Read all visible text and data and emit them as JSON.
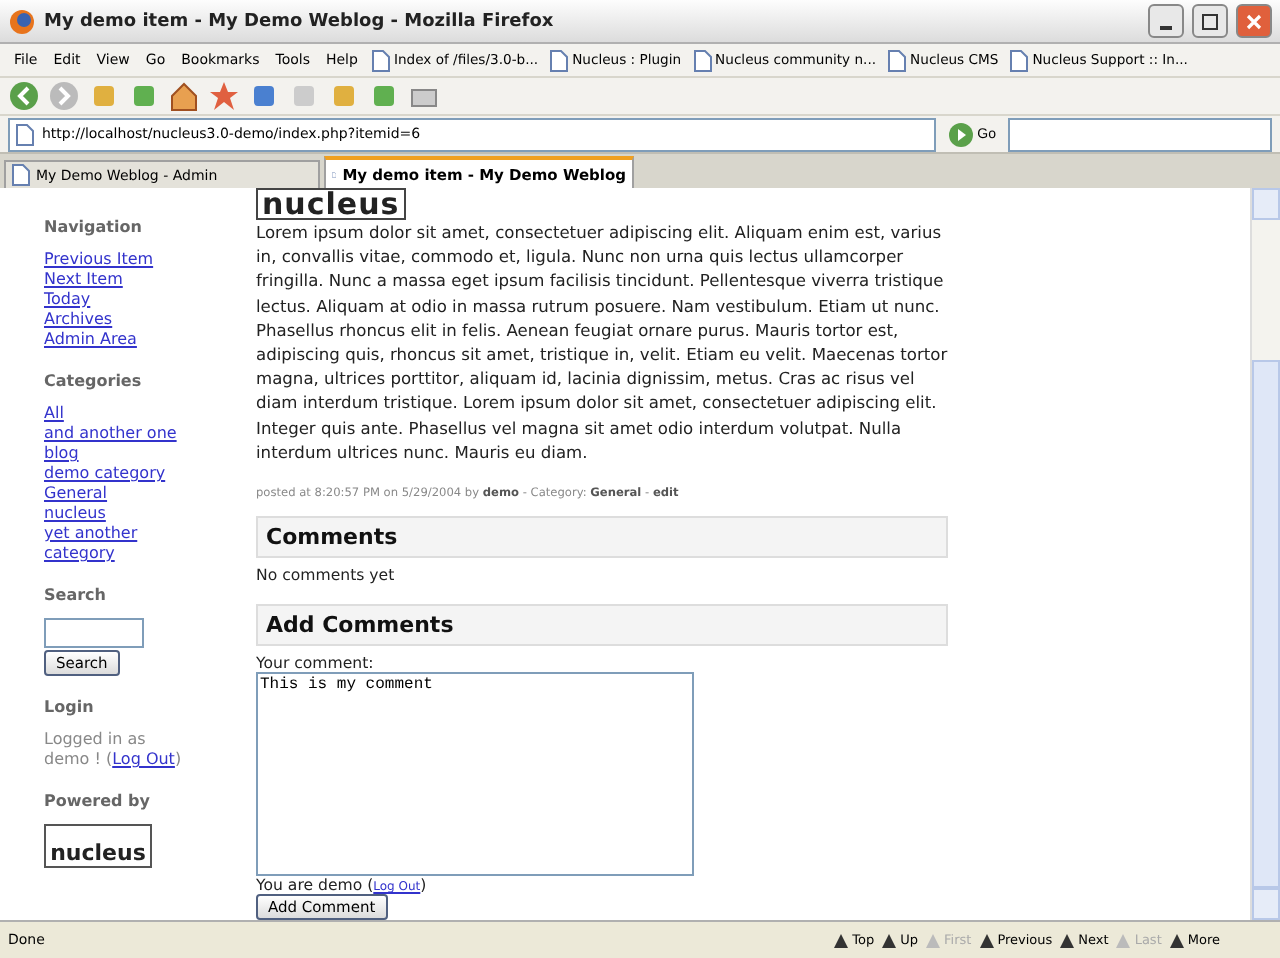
{
  "window": {
    "title": "My demo item - My Demo Weblog - Mozilla Firefox"
  },
  "menu": [
    "File",
    "Edit",
    "View",
    "Go",
    "Bookmarks",
    "Tools",
    "Help"
  ],
  "bookmarks": [
    "Index of /files/3.0-b...",
    "Nucleus : Plugin",
    "Nucleus community n...",
    "Nucleus CMS",
    "Nucleus Support :: In..."
  ],
  "address": {
    "url": "http://localhost/nucleus3.0-demo/index.php?itemid=6",
    "go": "Go"
  },
  "tabs": [
    {
      "label": "My Demo Weblog - Admin",
      "selected": false
    },
    {
      "label": "My demo item - My Demo Weblog",
      "selected": true
    }
  ],
  "sidebar": {
    "sections": [
      {
        "kind": "links",
        "heading": "Navigation",
        "links": [
          "Previous Item",
          "Next Item",
          "Today",
          "Archives",
          "Admin Area"
        ]
      },
      {
        "kind": "links",
        "heading": "Categories",
        "links": [
          "All",
          "and another one",
          "blog",
          "demo category",
          "General",
          "nucleus",
          "yet another category"
        ]
      },
      {
        "kind": "search",
        "heading": "Search",
        "button": "Search"
      },
      {
        "kind": "login",
        "heading": "Login",
        "text": "Logged in as demo ! (",
        "link": "Log Out",
        "after": ")"
      },
      {
        "kind": "logo",
        "heading": "Powered by",
        "logo": "nucleus"
      }
    ]
  },
  "post": {
    "logo": "nucleus",
    "body": "Lorem ipsum dolor sit amet, consectetuer adipiscing elit. Aliquam enim est, varius in, convallis vitae, commodo et, ligula. Nunc non urna quis lectus ullamcorper fringilla. Nunc a massa eget ipsum facilisis tincidunt. Pellentesque viverra tristique lectus. Aliquam at odio in massa rutrum posuere. Nam vestibulum. Etiam ut nunc. Phasellus rhoncus elit in felis. Aenean feugiat ornare purus. Mauris tortor est, adipiscing quis, rhoncus sit amet, tristique in, velit. Etiam eu velit. Maecenas tortor magna, ultrices porttitor, aliquam id, lacinia dignissim, metus. Cras ac risus vel diam interdum tristique. Lorem ipsum dolor sit amet, consectetuer adipiscing elit. Integer quis ante. Phasellus vel magna sit amet odio interdum volutpat. Nulla interdum ultrices nunc. Mauris eu diam.",
    "meta": "posted at 8:20:57 PM on 5/29/2004 by **demo** - Category: **General** - **edit**"
  },
  "comments": {
    "heading": "Comments",
    "empty": "No comments yet"
  },
  "add_comment": {
    "heading": "Add Comments",
    "label": "Your comment:",
    "value": "This is my comment",
    "user_text": "You are demo (",
    "logout": "Log Out",
    "user_after": ")",
    "button": "Add Comment"
  },
  "status_bar": {
    "text": "Done",
    "items": [
      {
        "label": "Top",
        "disabled": false
      },
      {
        "label": "Up",
        "disabled": false
      },
      {
        "label": "First",
        "disabled": true
      },
      {
        "label": "Previous",
        "disabled": false
      },
      {
        "label": "Next",
        "disabled": false
      },
      {
        "label": "Last",
        "disabled": true
      },
      {
        "label": "More",
        "disabled": false
      }
    ]
  }
}
